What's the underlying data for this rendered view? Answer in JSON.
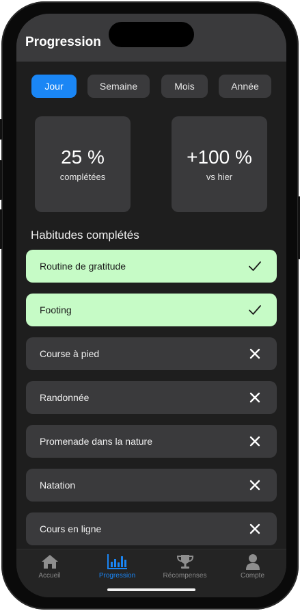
{
  "header": {
    "title": "Progression"
  },
  "periods": [
    {
      "label": "Jour",
      "active": true
    },
    {
      "label": "Semaine",
      "active": false
    },
    {
      "label": "Mois",
      "active": false
    },
    {
      "label": "Année",
      "active": false
    }
  ],
  "stats": [
    {
      "value": "25 %",
      "caption": "complétées"
    },
    {
      "value": "+100 %",
      "caption": "vs hier"
    }
  ],
  "section_title": "Habitudes complétés",
  "habits": [
    {
      "name": "Routine de gratitude",
      "status": "done",
      "icon": "check-icon"
    },
    {
      "name": "Footing",
      "status": "done",
      "icon": "check-icon"
    },
    {
      "name": "Course à pied",
      "status": "missed",
      "icon": "cross-icon"
    },
    {
      "name": "Randonnée",
      "status": "missed",
      "icon": "cross-icon"
    },
    {
      "name": "Promenade dans la nature",
      "status": "missed",
      "icon": "cross-icon"
    },
    {
      "name": "Natation",
      "status": "missed",
      "icon": "cross-icon"
    },
    {
      "name": "Cours en ligne",
      "status": "missed",
      "icon": "cross-icon"
    }
  ],
  "tabbar": [
    {
      "label": "Accueil",
      "icon": "home-icon",
      "active": false
    },
    {
      "label": "Progression",
      "icon": "bar-chart-icon",
      "active": true
    },
    {
      "label": "Récompenses",
      "icon": "trophy-icon",
      "active": false
    },
    {
      "label": "Compte",
      "icon": "user-icon",
      "active": false
    }
  ],
  "colors": {
    "accent": "#1a86f5",
    "done_background": "#c6fbc6",
    "card_background": "#3a3a3c",
    "screen_background": "#1e1e1e"
  }
}
